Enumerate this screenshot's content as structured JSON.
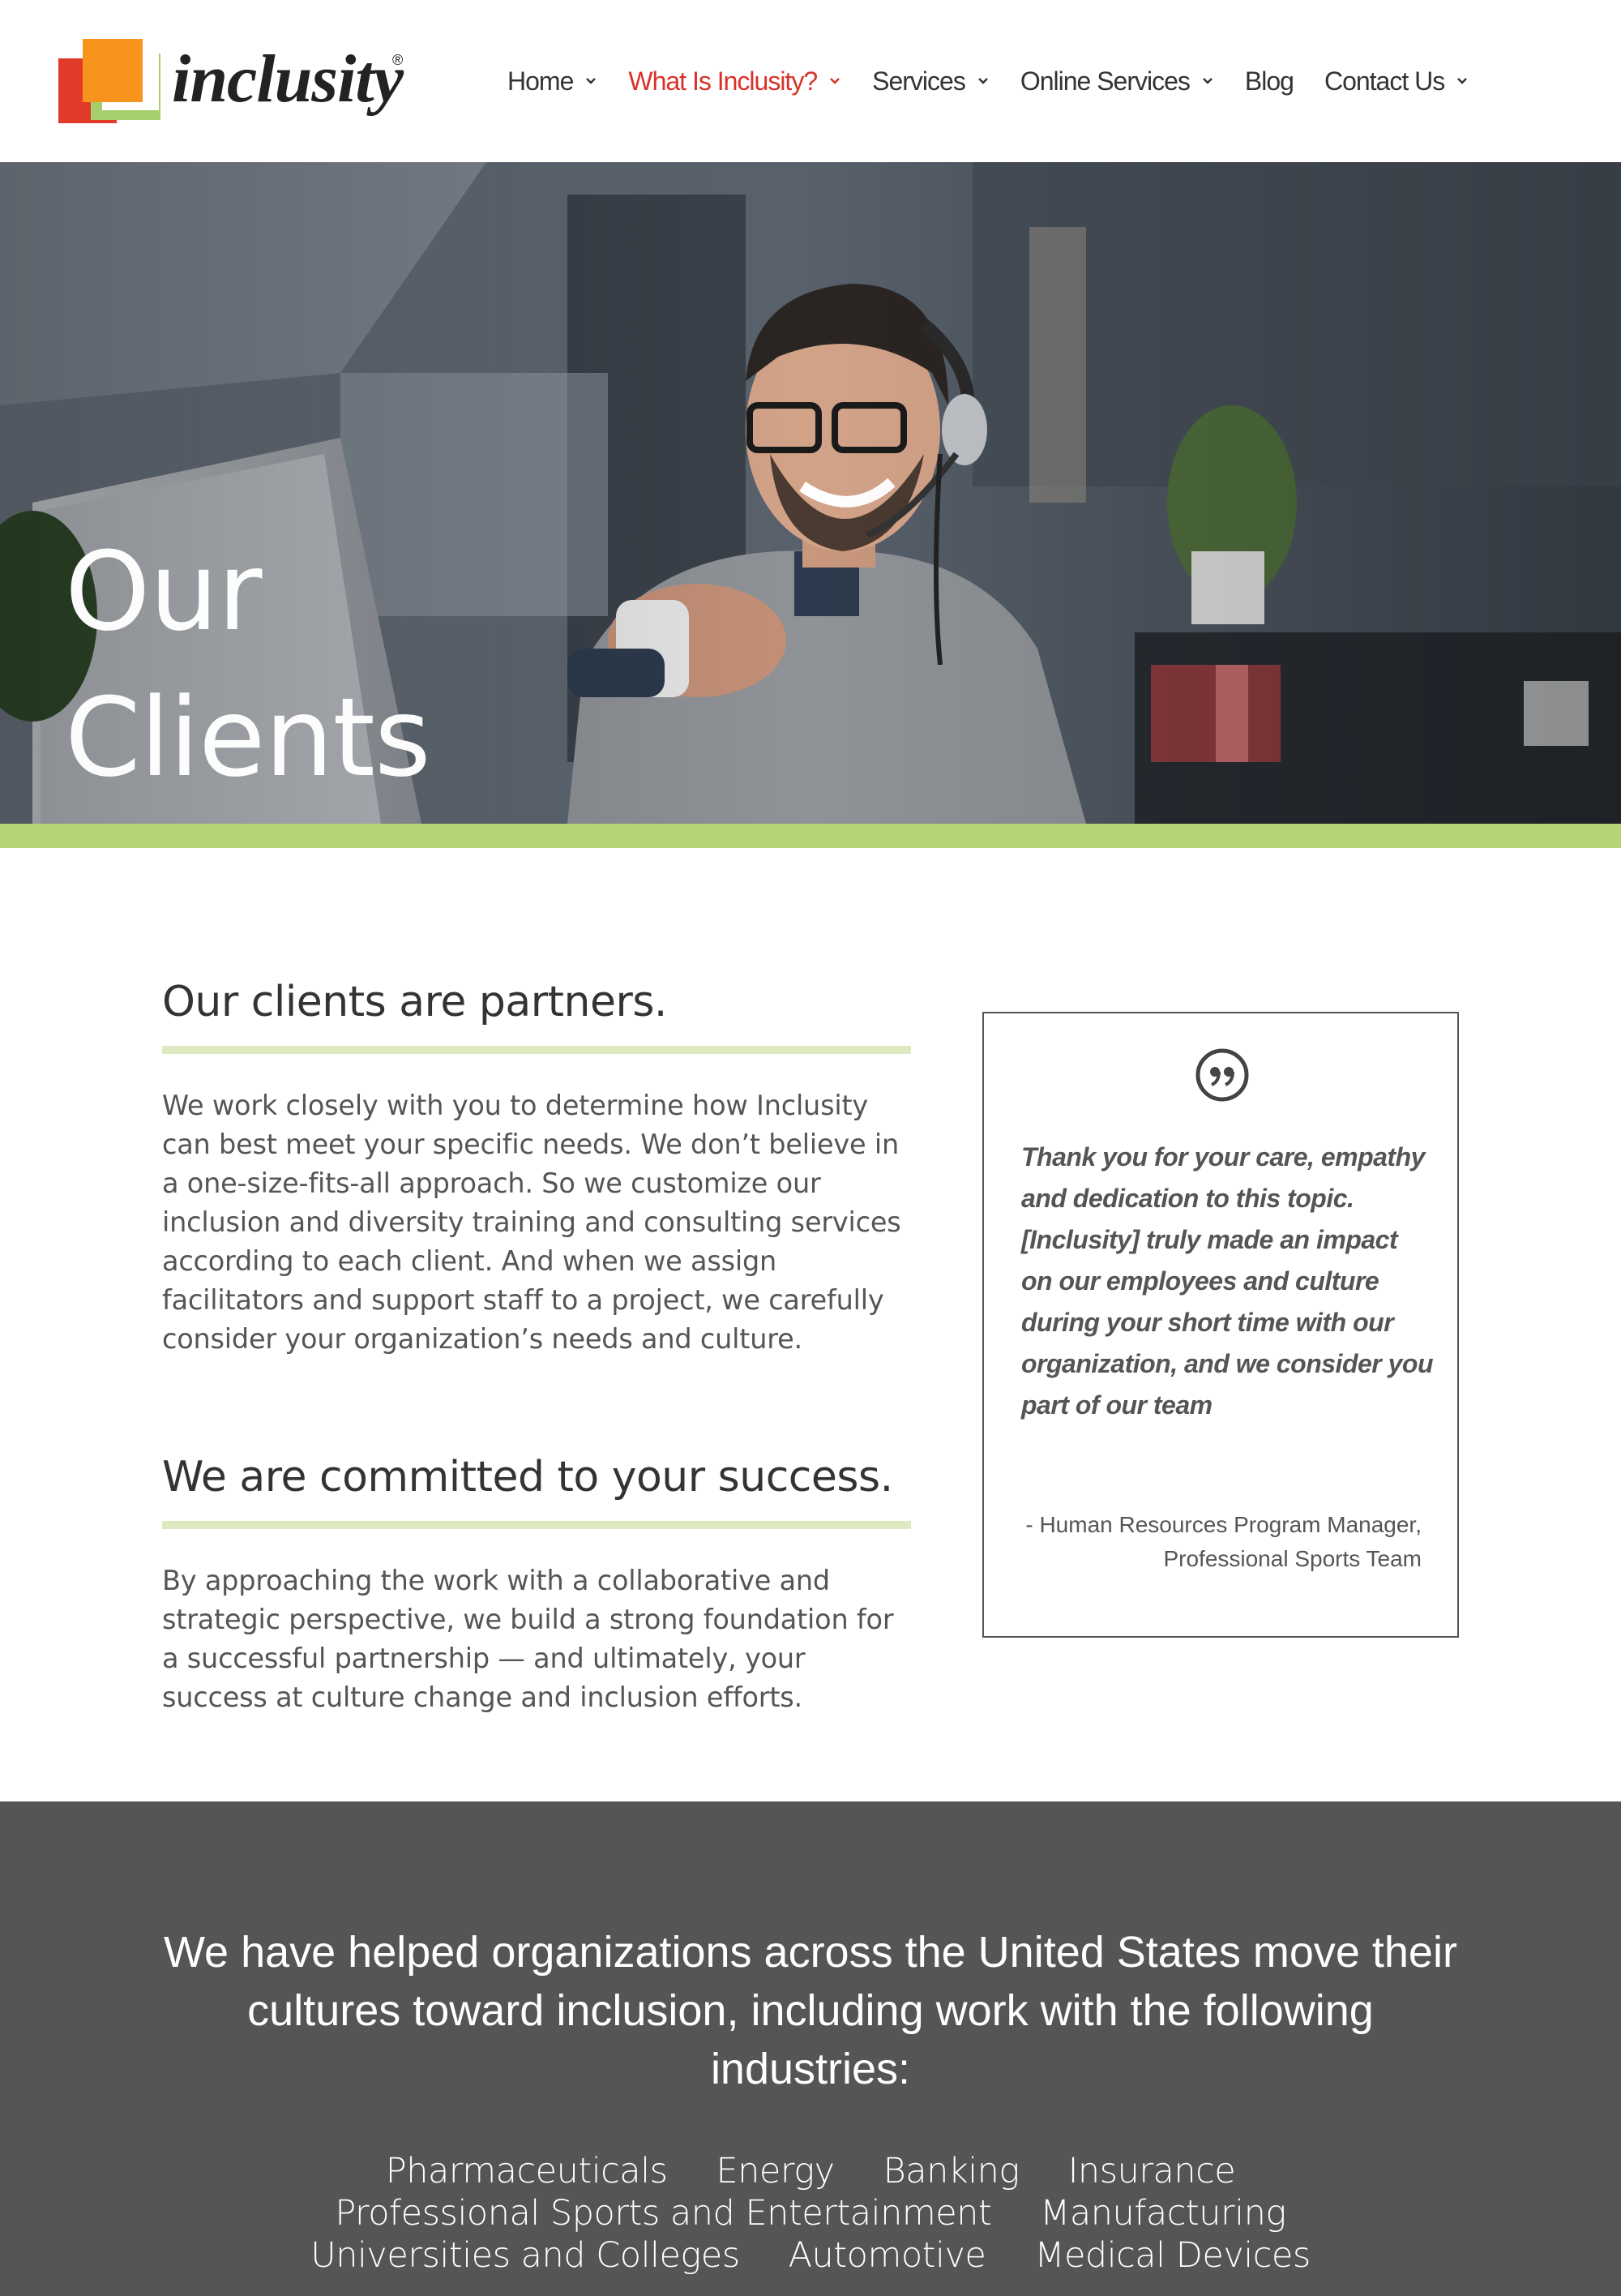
{
  "header": {
    "logo_text": "inclusity",
    "logo_reg": "®",
    "nav": [
      {
        "label": "Home",
        "has_dropdown": true,
        "active": false
      },
      {
        "label": "What Is Inclusity?",
        "has_dropdown": true,
        "active": true
      },
      {
        "label": "Services",
        "has_dropdown": true,
        "active": false
      },
      {
        "label": "Online Services",
        "has_dropdown": true,
        "active": false
      },
      {
        "label": "Blog",
        "has_dropdown": false,
        "active": false
      },
      {
        "label": "Contact Us",
        "has_dropdown": true,
        "active": false
      }
    ]
  },
  "hero": {
    "title_line1": "Our",
    "title_line2": "Clients"
  },
  "sections": [
    {
      "heading": "Our clients are partners.",
      "text": "We work closely with you to determine how Inclusity can best meet your specific needs. We don’t believe in a one-size-fits-all approach. So we customize our inclusion and diversity training and consulting services according to each client. And when we assign facilitators and support staff to a project, we carefully consider your organization’s needs and culture."
    },
    {
      "heading": "We are committed to your success.",
      "text": "By approaching the work with a collaborative and strategic perspective, we build a strong foundation for a successful partnership — and ultimately, your success at culture change and inclusion efforts."
    }
  ],
  "testimonial": {
    "quote": "Thank you for your care, empathy and dedication to this topic. [Inclusity] truly made an impact on our employees and culture during your short time with our organization, and we consider you part of our team",
    "attribution_line1": "- Human Resources Program Manager,",
    "attribution_line2": "Professional Sports Team"
  },
  "industries": {
    "heading": "We have helped organizations across the United States move their cultures toward inclusion, including work with the following industries:",
    "rows": [
      [
        "Pharmaceuticals",
        "Energy",
        "Banking",
        "Insurance"
      ],
      [
        "Professional Sports and Entertainment",
        "Manufacturing"
      ],
      [
        "Universities and Colleges",
        "Automotive",
        "Medical Devices"
      ]
    ]
  },
  "colors": {
    "accent_red": "#d8312a",
    "accent_green": "#b3d374",
    "rule_green": "#dde9be",
    "footer_gray": "#555555",
    "logo_orange": "#f7941d",
    "logo_red": "#e03a2a",
    "logo_green": "#a6cf6b"
  },
  "icons": {
    "nav_dropdown": "chevron-down-icon",
    "quote": "quote-icon"
  }
}
